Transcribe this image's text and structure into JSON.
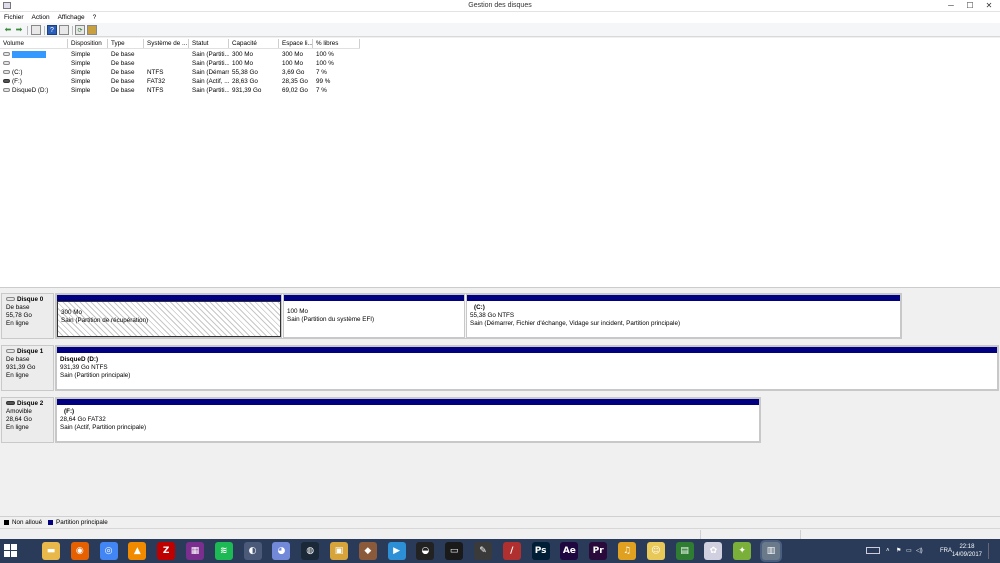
{
  "window": {
    "title": "Gestion des disques",
    "min_glyph": "─",
    "max_glyph": "☐",
    "close_glyph": "✕"
  },
  "menu": [
    "Fichier",
    "Action",
    "Affichage",
    "?"
  ],
  "toolbar": {
    "back_glyph": "⬅",
    "forward_glyph": "➡",
    "help_glyph": "?",
    "refresh_glyph": "⟳"
  },
  "columns": [
    "Volume",
    "Disposition",
    "Type",
    "Système de ...",
    "Statut",
    "Capacité",
    "Espace li...",
    "% libres"
  ],
  "volumes": [
    {
      "name": "",
      "layout": "Simple",
      "type": "De base",
      "fs": "",
      "status": "Sain (Partiti...",
      "capacity": "300 Mo",
      "free": "300 Mo",
      "pct": "100 %"
    },
    {
      "name": "",
      "layout": "Simple",
      "type": "De base",
      "fs": "",
      "status": "Sain (Partiti...",
      "capacity": "100 Mo",
      "free": "100 Mo",
      "pct": "100 %"
    },
    {
      "name": "(C:)",
      "layout": "Simple",
      "type": "De base",
      "fs": "NTFS",
      "status": "Sain (Démarr...",
      "capacity": "55,38 Go",
      "free": "3,69 Go",
      "pct": "7 %"
    },
    {
      "name": "(F:)",
      "layout": "Simple",
      "type": "De base",
      "fs": "FAT32",
      "status": "Sain (Actif, ...",
      "capacity": "28,63 Go",
      "free": "28,35 Go",
      "pct": "99 %"
    },
    {
      "name": "DisqueD (D:)",
      "layout": "Simple",
      "type": "De base",
      "fs": "NTFS",
      "status": "Sain (Partiti...",
      "capacity": "931,39 Go",
      "free": "69,02 Go",
      "pct": "7 %"
    }
  ],
  "disks": [
    {
      "name": "Disque 0",
      "kind": "De base",
      "size": "55,78 Go",
      "state": "En ligne",
      "partitions": [
        {
          "name": "",
          "size": "300 Mo",
          "status": "Sain (Partition de récupération)"
        },
        {
          "name": "",
          "size": "100 Mo",
          "status": "Sain (Partition du système EFI)"
        },
        {
          "name": "(C:)",
          "size": "55,38 Go NTFS",
          "status": "Sain (Démarrer, Fichier d'échange, Vidage sur incident, Partition principale)"
        }
      ]
    },
    {
      "name": "Disque 1",
      "kind": "De base",
      "size": "931,39 Go",
      "state": "En ligne",
      "partitions": [
        {
          "name": "DisqueD  (D:)",
          "size": "931,39 Go NTFS",
          "status": "Sain (Partition principale)"
        }
      ]
    },
    {
      "name": "Disque 2",
      "kind": "Amovible",
      "size": "28,64 Go",
      "state": "En ligne",
      "partitions": [
        {
          "name": "(F:)",
          "size": "28,64 Go FAT32",
          "status": "Sain (Actif, Partition principale)"
        }
      ]
    }
  ],
  "legend": [
    {
      "label": "Non alloué",
      "color": "#000000"
    },
    {
      "label": "Partition principale",
      "color": "#000080"
    }
  ],
  "taskbar": {
    "apps": [
      {
        "name": "file-explorer-icon",
        "glyph": "▬",
        "color": "#e8b84a"
      },
      {
        "name": "firefox-icon",
        "glyph": "◉",
        "color": "#e66000"
      },
      {
        "name": "chrome-icon",
        "glyph": "◎",
        "color": "#4285f4"
      },
      {
        "name": "vlc-icon",
        "glyph": "▲",
        "color": "#f28a00"
      },
      {
        "name": "filezilla-icon",
        "glyph": "Z",
        "color": "#bf0000"
      },
      {
        "name": "winrar-icon",
        "glyph": "▦",
        "color": "#7a2f8f"
      },
      {
        "name": "spotify-icon",
        "glyph": "≋",
        "color": "#1db954"
      },
      {
        "name": "gamepad-icon",
        "glyph": "◐",
        "color": "#4a5a78"
      },
      {
        "name": "discord-icon",
        "glyph": "◕",
        "color": "#7289da"
      },
      {
        "name": "steam-icon",
        "glyph": "◍",
        "color": "#1b2838"
      },
      {
        "name": "media-icon",
        "glyph": "▣",
        "color": "#d6a43a"
      },
      {
        "name": "game-icon",
        "glyph": "◆",
        "color": "#8a5a3a"
      },
      {
        "name": "player-icon",
        "glyph": "▶",
        "color": "#2d8fd6"
      },
      {
        "name": "obs-icon",
        "glyph": "◒",
        "color": "#222222"
      },
      {
        "name": "monitor-icon",
        "glyph": "▭",
        "color": "#1a1a1a"
      },
      {
        "name": "tool-icon",
        "glyph": "✎",
        "color": "#3a3a3a"
      },
      {
        "name": "pen-icon",
        "glyph": "/",
        "color": "#b03030"
      },
      {
        "name": "photoshop-icon",
        "glyph": "Ps",
        "color": "#001e36"
      },
      {
        "name": "after-effects-icon",
        "glyph": "Ae",
        "color": "#1f0740"
      },
      {
        "name": "premiere-icon",
        "glyph": "Pr",
        "color": "#2a0a3a"
      },
      {
        "name": "audio-icon",
        "glyph": "♫",
        "color": "#e0a020"
      },
      {
        "name": "character-icon",
        "glyph": "☺",
        "color": "#e8c858"
      },
      {
        "name": "spreadsheet-icon",
        "glyph": "▤",
        "color": "#2e7d32"
      },
      {
        "name": "app-icon",
        "glyph": "✿",
        "color": "#d0d0e0"
      },
      {
        "name": "utility-icon",
        "glyph": "✦",
        "color": "#7ab03a"
      },
      {
        "name": "disk-management-icon",
        "glyph": "▥",
        "color": "#6a7a8a"
      }
    ],
    "language": "FRA",
    "time": "22:18",
    "date": "14/09/2017"
  }
}
